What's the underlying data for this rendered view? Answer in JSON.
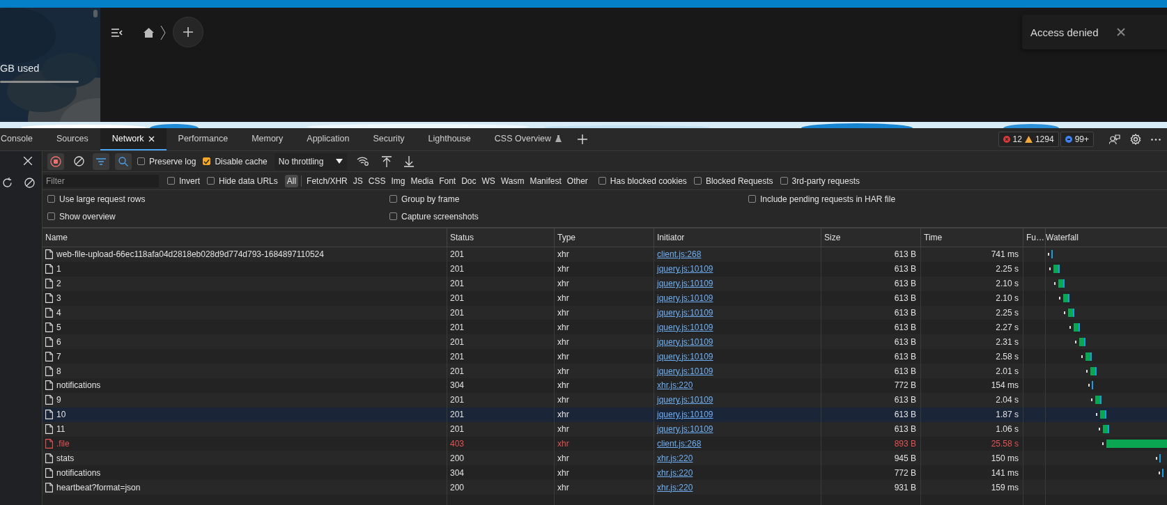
{
  "app": {
    "storage_label": "GB used",
    "toast": {
      "message": "Access denied"
    }
  },
  "devtools": {
    "tabs": [
      {
        "label": "Console",
        "selected": false,
        "kind": "plain"
      },
      {
        "label": "Sources",
        "selected": false,
        "kind": "plain"
      },
      {
        "label": "Network",
        "selected": true,
        "kind": "closable"
      },
      {
        "label": "Performance",
        "selected": false,
        "kind": "plain"
      },
      {
        "label": "Memory",
        "selected": false,
        "kind": "plain"
      },
      {
        "label": "Application",
        "selected": false,
        "kind": "plain"
      },
      {
        "label": "Security",
        "selected": false,
        "kind": "plain"
      },
      {
        "label": "Lighthouse",
        "selected": false,
        "kind": "plain"
      },
      {
        "label": "CSS Overview",
        "selected": false,
        "kind": "experimental"
      }
    ],
    "counters": {
      "errors": "12",
      "warnings": "1294",
      "issues": "99+"
    }
  },
  "toolbar": {
    "checkboxes": [
      {
        "label": "Preserve log",
        "checked": false
      },
      {
        "label": "Disable cache",
        "checked": true
      }
    ],
    "throttling": "No throttling"
  },
  "filter_bar": {
    "placeholder": "Filter",
    "options": [
      {
        "label": "Invert",
        "checked": false
      },
      {
        "label": "Hide data URLs",
        "checked": false
      }
    ],
    "types": [
      {
        "label": "All",
        "selected": true
      },
      {
        "label": "Fetch/XHR",
        "selected": false
      },
      {
        "label": "JS",
        "selected": false
      },
      {
        "label": "CSS",
        "selected": false
      },
      {
        "label": "Img",
        "selected": false
      },
      {
        "label": "Media",
        "selected": false
      },
      {
        "label": "Font",
        "selected": false
      },
      {
        "label": "Doc",
        "selected": false
      },
      {
        "label": "WS",
        "selected": false
      },
      {
        "label": "Wasm",
        "selected": false
      },
      {
        "label": "Manifest",
        "selected": false
      },
      {
        "label": "Other",
        "selected": false
      }
    ],
    "more_options": [
      {
        "label": "Has blocked cookies",
        "checked": false
      },
      {
        "label": "Blocked Requests",
        "checked": false
      },
      {
        "label": "3rd-party requests",
        "checked": false
      }
    ]
  },
  "settings": {
    "columns": [
      [
        {
          "label": "Use large request rows",
          "checked": false
        },
        {
          "label": "Show overview",
          "checked": false
        }
      ],
      [
        {
          "label": "Group by frame",
          "checked": false
        },
        {
          "label": "Capture screenshots",
          "checked": false
        }
      ],
      [
        {
          "label": "Include pending requests in HAR file",
          "checked": false
        }
      ]
    ]
  },
  "table": {
    "columns": [
      "Name",
      "Status",
      "Type",
      "Initiator",
      "Size",
      "Time",
      "Fu…",
      "Waterfall"
    ],
    "rows": [
      {
        "name": "web-file-upload-66ec118afa04d2818eb028d9d774d793-1684897110524",
        "status": "201",
        "type": "xhr",
        "initiator": "client.js:268",
        "size": "613 B",
        "time": "741 ms",
        "selected": false,
        "failed": false
      },
      {
        "name": "1",
        "status": "201",
        "type": "xhr",
        "initiator": "jquery.js:10109",
        "size": "613 B",
        "time": "2.25 s",
        "selected": false,
        "failed": false
      },
      {
        "name": "2",
        "status": "201",
        "type": "xhr",
        "initiator": "jquery.js:10109",
        "size": "613 B",
        "time": "2.10 s",
        "selected": false,
        "failed": false
      },
      {
        "name": "3",
        "status": "201",
        "type": "xhr",
        "initiator": "jquery.js:10109",
        "size": "613 B",
        "time": "2.10 s",
        "selected": false,
        "failed": false
      },
      {
        "name": "4",
        "status": "201",
        "type": "xhr",
        "initiator": "jquery.js:10109",
        "size": "613 B",
        "time": "2.25 s",
        "selected": false,
        "failed": false
      },
      {
        "name": "5",
        "status": "201",
        "type": "xhr",
        "initiator": "jquery.js:10109",
        "size": "613 B",
        "time": "2.27 s",
        "selected": false,
        "failed": false
      },
      {
        "name": "6",
        "status": "201",
        "type": "xhr",
        "initiator": "jquery.js:10109",
        "size": "613 B",
        "time": "2.31 s",
        "selected": false,
        "failed": false
      },
      {
        "name": "7",
        "status": "201",
        "type": "xhr",
        "initiator": "jquery.js:10109",
        "size": "613 B",
        "time": "2.58 s",
        "selected": false,
        "failed": false
      },
      {
        "name": "8",
        "status": "201",
        "type": "xhr",
        "initiator": "jquery.js:10109",
        "size": "613 B",
        "time": "2.01 s",
        "selected": false,
        "failed": false
      },
      {
        "name": "notifications",
        "status": "304",
        "type": "xhr",
        "initiator": "xhr.js:220",
        "size": "772 B",
        "time": "154 ms",
        "selected": false,
        "failed": false
      },
      {
        "name": "9",
        "status": "201",
        "type": "xhr",
        "initiator": "jquery.js:10109",
        "size": "613 B",
        "time": "2.04 s",
        "selected": false,
        "failed": false
      },
      {
        "name": "10",
        "status": "201",
        "type": "xhr",
        "initiator": "jquery.js:10109",
        "size": "613 B",
        "time": "1.87 s",
        "selected": true,
        "failed": false
      },
      {
        "name": "11",
        "status": "201",
        "type": "xhr",
        "initiator": "jquery.js:10109",
        "size": "613 B",
        "time": "1.06 s",
        "selected": false,
        "failed": false
      },
      {
        "name": ".file",
        "status": "403",
        "type": "xhr",
        "initiator": "client.js:268",
        "size": "893 B",
        "time": "25.58 s",
        "selected": false,
        "failed": true
      },
      {
        "name": "stats",
        "status": "200",
        "type": "xhr",
        "initiator": "xhr.js:220",
        "size": "945 B",
        "time": "150 ms",
        "selected": false,
        "failed": false
      },
      {
        "name": "notifications",
        "status": "304",
        "type": "xhr",
        "initiator": "xhr.js:220",
        "size": "772 B",
        "time": "141 ms",
        "selected": false,
        "failed": false
      },
      {
        "name": "heartbeat?format=json",
        "status": "200",
        "type": "xhr",
        "initiator": "xhr.js:220",
        "size": "931 B",
        "time": "159 ms",
        "selected": false,
        "failed": false
      }
    ]
  }
}
